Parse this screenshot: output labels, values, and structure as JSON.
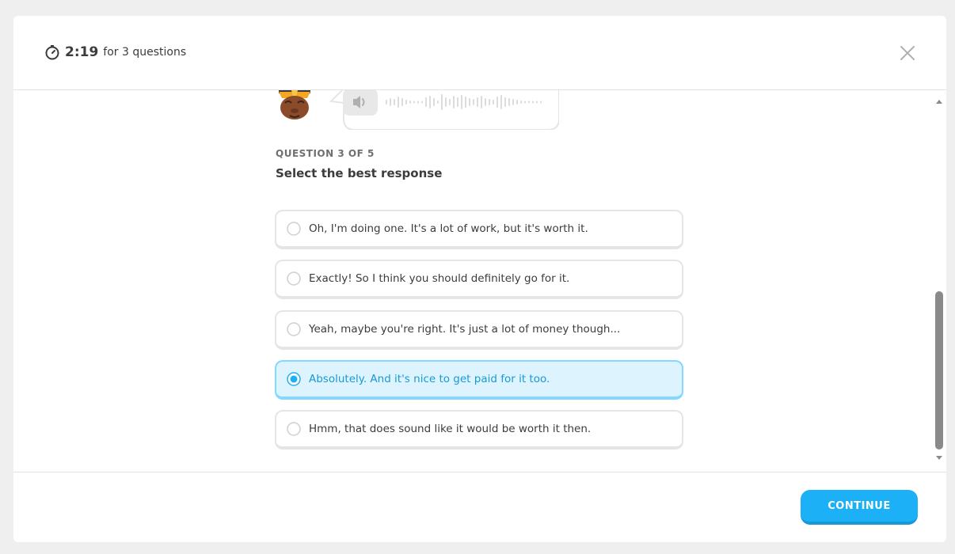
{
  "header": {
    "timer_time": "2:19",
    "timer_label": "for 3 questions"
  },
  "question": {
    "counter": "QUESTION 3 OF 5",
    "title": "Select the best response"
  },
  "options": [
    {
      "label": "Oh, I'm doing one. It's a lot of work, but it's worth it.",
      "selected": false
    },
    {
      "label": "Exactly! So I think you should definitely go for it.",
      "selected": false
    },
    {
      "label": "Yeah, maybe you're right. It's just a lot of money though...",
      "selected": false
    },
    {
      "label": "Absolutely. And it's nice to get paid for it too.",
      "selected": true
    },
    {
      "label": "Hmm, that does sound like it would be worth it then.",
      "selected": false
    }
  ],
  "footer": {
    "continue_label": "CONTINUE"
  },
  "icons": {
    "timer": "stopwatch-icon",
    "close": "close-icon",
    "audio": "speaker-icon",
    "radio": "radio-icon"
  },
  "colors": {
    "accent": "#1cb0f6",
    "accent_dark": "#1899d6",
    "selected_bg": "#ddf4ff",
    "selected_border": "#84d8ff",
    "text": "#3c3c3c",
    "muted": "#6f6f6f"
  }
}
